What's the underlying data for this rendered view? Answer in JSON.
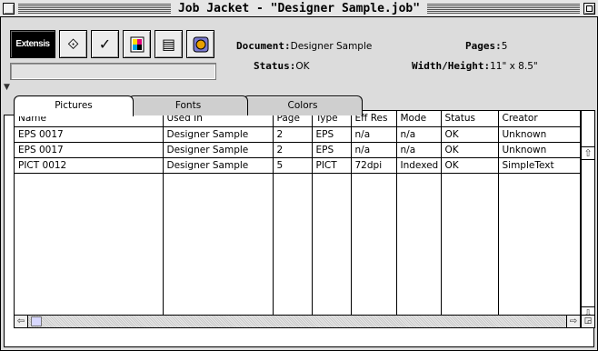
{
  "window": {
    "title": "Job Jacket - \"Designer Sample.job\""
  },
  "toolbar": {
    "buttons": [
      {
        "name": "extensis-button",
        "label": "Extensis"
      },
      {
        "name": "collect-button",
        "icon": "arrow-box-icon",
        "glyph": "⟐"
      },
      {
        "name": "check-button",
        "icon": "checkmark-icon",
        "glyph": "✓"
      },
      {
        "name": "color-button",
        "icon": "color-document-icon",
        "glyph": "▦"
      },
      {
        "name": "report-button",
        "icon": "report-icon",
        "glyph": "▤"
      },
      {
        "name": "scan-button",
        "icon": "globe-icon",
        "glyph": "◉"
      }
    ]
  },
  "info": {
    "document_label": "Document:",
    "document_value": "Designer Sample",
    "status_label": "Status:",
    "status_value": "OK",
    "pages_label": "Pages:",
    "pages_value": "5",
    "size_label": "Width/Height:",
    "size_value": "11\" x 8.5\""
  },
  "tabs": [
    {
      "label": "Pictures",
      "active": true
    },
    {
      "label": "Fonts",
      "active": false
    },
    {
      "label": "Colors",
      "active": false
    }
  ],
  "table": {
    "columns": [
      "Name",
      "Used In",
      "Page",
      "Type",
      "Eff Res",
      "Mode",
      "Status",
      "Creator"
    ],
    "rows": [
      [
        "EPS 0017",
        "Designer Sample",
        "2",
        "EPS",
        "n/a",
        "n/a",
        "OK",
        "Unknown"
      ],
      [
        "EPS 0017",
        "Designer Sample",
        "2",
        "EPS",
        "n/a",
        "n/a",
        "OK",
        "Unknown"
      ],
      [
        "PICT 0012",
        "Designer Sample",
        "5",
        "PICT",
        "72dpi",
        "Indexed",
        "OK",
        "SimpleText"
      ]
    ]
  },
  "icons": {
    "close": "close-box-icon",
    "zoom": "zoom-box-icon",
    "disclosure": "triangle-down-icon",
    "scroll_up": "arrow-up-icon",
    "scroll_down": "arrow-down-icon",
    "scroll_left": "arrow-left-icon",
    "scroll_right": "arrow-right-icon",
    "grow": "grow-box-icon"
  }
}
